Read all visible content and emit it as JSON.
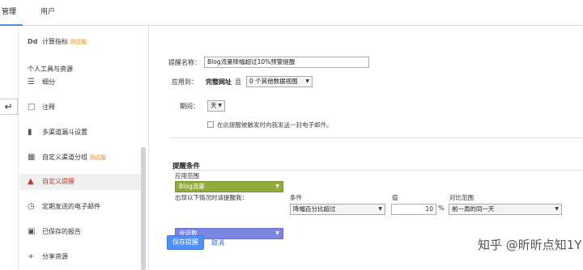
{
  "tabs": {
    "admin": "管理",
    "user": "用户"
  },
  "sidebar": {
    "top_item": {
      "icon": "Dd",
      "label": "计算指标",
      "badge": "测试版"
    },
    "section_title": "个人工具与资源",
    "items": [
      {
        "icon": "segments-icon",
        "label": "细分"
      },
      {
        "icon": "annotations-icon",
        "label": "注释"
      },
      {
        "icon": "funnel-icon",
        "label": "多渠道漏斗设置"
      },
      {
        "icon": "channel-grouping-icon",
        "label": "自定义渠道分组",
        "badge": "测试版"
      },
      {
        "icon": "megaphone-icon",
        "label": "自定义提醒"
      },
      {
        "icon": "clock-icon",
        "label": "定期发送的电子邮件"
      },
      {
        "icon": "document-icon",
        "label": "已保存的报告"
      },
      {
        "icon": "share-icon",
        "label": "分享资源"
      }
    ]
  },
  "form": {
    "alert_name_label": "提醒名称：",
    "alert_name_value": "Blog流量降幅超过10%预警提醒",
    "apply_to_label": "应用到：",
    "apply_to_value": "完整网址",
    "apply_and": "且",
    "other_views": "0 个其他数据视图",
    "period_label": "期间：",
    "period_value": "天",
    "email_checkbox_label": "在此提醒被触发时向我发送一封电子邮件。"
  },
  "conditions": {
    "heading": "提醒条件",
    "scope_label": "应用范围",
    "scope_value": "Blog流量",
    "trigger_label": "出现以下情况时请提醒我：",
    "metric_value": "会话数",
    "condition_header": "条件",
    "condition_value": "降幅百分比超过",
    "value_header": "值",
    "value_value": "10",
    "value_unit": "%",
    "compare_header": "对比范围",
    "compare_value": "前一周的同一天"
  },
  "actions": {
    "save": "保存提醒",
    "cancel": "取消"
  },
  "watermark": "知乎 @昕昕点知1Y",
  "colors": {
    "accent": "#4d90fe",
    "scope_green": "#8fac3c",
    "metric_purple": "#7b86e3",
    "selected_red": "#c0392b",
    "beta_orange": "#e08a1e"
  }
}
